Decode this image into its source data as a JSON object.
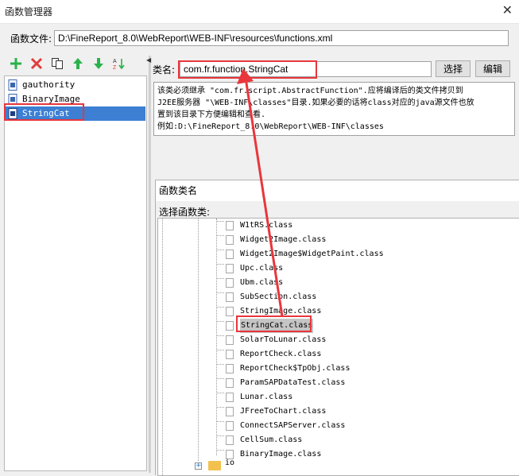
{
  "window": {
    "title": "函数管理器",
    "close_glyph": "✕"
  },
  "file_row": {
    "label": "函数文件:",
    "path": "D:\\FineReport_8.0\\WebReport\\WEB-INF\\resources\\functions.xml"
  },
  "toolbar": {
    "add_icon": "plus-icon",
    "delete_icon": "delete-icon",
    "copy_icon": "copy-icon",
    "move_up_icon": "arrow-up-icon",
    "move_down_icon": "arrow-down-icon",
    "sort_icon": "sort-az-icon"
  },
  "function_list": {
    "items": [
      "gauthority",
      "BinaryImage",
      "StringCat"
    ],
    "selected": "StringCat"
  },
  "class_field": {
    "label": "类名:",
    "value": "com.fr.function.StringCat",
    "select_button": "选择",
    "edit_button": "编辑"
  },
  "description": {
    "lines": [
      "该类必须继承 \"com.fr.script.AbstractFunction\".应将编译后的类文件拷贝到",
      "J2EE服务器 \"\\WEB-INF\\classes\"目录.如果必要的话将class对应的java源文件也放",
      "置到该目录下方便编辑和查看.",
      "例如:D:\\FineReport_8.0\\WebReport\\WEB-INF\\classes"
    ]
  },
  "class_dialog": {
    "title": "函数类名",
    "subtitle": "选择函数类:",
    "tree_items": [
      "W1tRS.class",
      "Widget2Image.class",
      "Widget2Image$WidgetPaint.class",
      "Upc.class",
      "Ubm.class",
      "SubSection.class",
      "StringImage.class",
      "StringCat.class",
      "SolarToLunar.class",
      "ReportCheck.class",
      "ReportCheck$TpObj.class",
      "ParamSAPDataTest.class",
      "Lunar.class",
      "JFreeToChart.class",
      "ConnectSAPServer.class",
      "CellSum.class",
      "BinaryImage.class"
    ],
    "selected": "StringCat.class",
    "folder_label": "io"
  },
  "colors": {
    "selection_blue": "#3c7fd3",
    "annotation_red": "#e8363c",
    "add_green": "#2bb24c",
    "delete_red": "#e23b3b"
  }
}
